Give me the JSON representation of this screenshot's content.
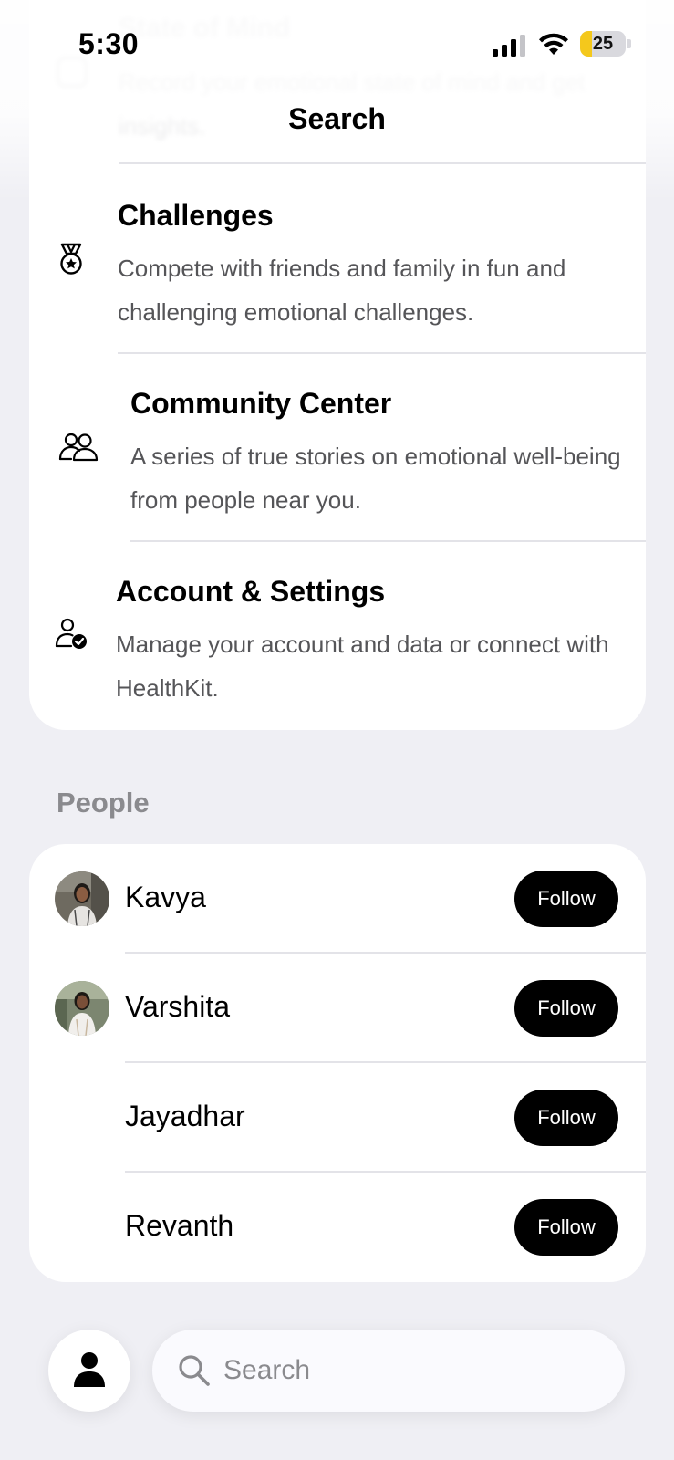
{
  "status_bar": {
    "time": "5:30",
    "battery_level": "25",
    "battery_fraction": 0.25,
    "battery_color": "#f4c81c"
  },
  "nav": {
    "title": "Search"
  },
  "faded_item": {
    "title": "State of Mind",
    "description": "Record your emotional state of mind and get insights.",
    "icon": "state-of-mind-icon"
  },
  "settings_items": [
    {
      "title": "Challenges",
      "description": "Compete with friends and family in fun and challenging emotional challenges.",
      "icon": "medal-icon"
    },
    {
      "title": "Community Center",
      "description": "A series of true stories on emotional well-being from people near you.",
      "icon": "people-icon"
    },
    {
      "title": "Account & Settings",
      "description": "Manage your account and data or connect with HealthKit.",
      "icon": "person-check-icon"
    }
  ],
  "people_section": {
    "header": "People",
    "people": [
      {
        "name": "Kavya",
        "has_avatar": true,
        "follow_label": "Follow"
      },
      {
        "name": "Varshita",
        "has_avatar": true,
        "follow_label": "Follow"
      },
      {
        "name": "Jayadhar",
        "has_avatar": false,
        "follow_label": "Follow"
      },
      {
        "name": "Revanth",
        "has_avatar": false,
        "follow_label": "Follow"
      }
    ]
  },
  "bottom_bar": {
    "profile_icon": "person-icon",
    "search_placeholder": "Search",
    "search_icon": "magnifier-icon"
  },
  "colors": {
    "background": "#efeff4",
    "card": "#ffffff",
    "button": "#000000",
    "secondary_text": "#8a8a8e"
  }
}
